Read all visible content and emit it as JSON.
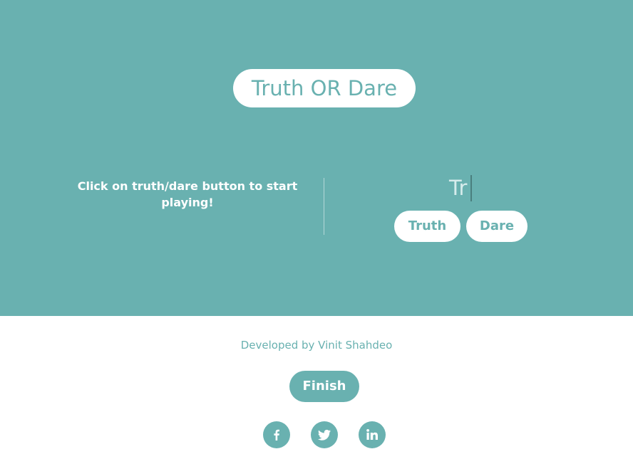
{
  "header": {
    "title": "Truth OR Dare"
  },
  "game": {
    "instruction": "Click on truth/dare button to start playing!",
    "typed_text": "Tr",
    "truth_label": "Truth",
    "dare_label": "Dare"
  },
  "footer": {
    "credit": "Developed by Vinit Shahdeo",
    "finish_label": "Finish",
    "social": [
      {
        "icon": "facebook-icon"
      },
      {
        "icon": "twitter-icon"
      },
      {
        "icon": "linkedin-icon"
      }
    ]
  },
  "colors": {
    "accent": "#69b1b0",
    "background_bottom": "#ffffff",
    "text_light": "#ffffff"
  }
}
